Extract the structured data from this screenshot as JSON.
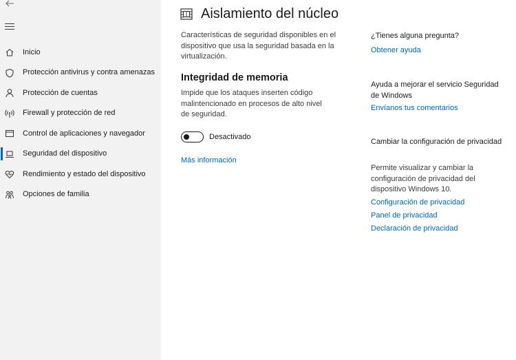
{
  "sidebar": {
    "items": [
      {
        "label": "Inicio",
        "icon": "home-icon"
      },
      {
        "label": "Protección antivirus y contra amenazas",
        "icon": "shield-icon"
      },
      {
        "label": "Protección de cuentas",
        "icon": "person-icon"
      },
      {
        "label": "Firewall y protección de red",
        "icon": "wifi-antenna-icon"
      },
      {
        "label": "Control de aplicaciones y navegador",
        "icon": "browser-window-icon"
      },
      {
        "label": "Seguridad del dispositivo",
        "icon": "laptop-icon",
        "active": true
      },
      {
        "label": "Rendimiento y estado del dispositivo",
        "icon": "heart-icon"
      },
      {
        "label": "Opciones de familia",
        "icon": "family-icon"
      }
    ]
  },
  "main": {
    "title": "Aislamiento del núcleo",
    "description": "Características de seguridad disponibles en el dispositivo que usa la seguridad basada en la virtualización.",
    "memory_integrity": {
      "title": "Integridad de memoria",
      "description": "Impide que los ataques inserten código malintencionado en procesos de alto nivel de seguridad.",
      "toggle_label": "Desactivado",
      "toggle_on": false
    },
    "more_info": "Más información"
  },
  "right_panel": {
    "question_heading": "¿Tienes alguna pregunta?",
    "help_link": "Obtener ayuda",
    "improve_heading": "Ayuda a mejorar el servicio Seguridad de Windows",
    "feedback_link": "Envíanos tus comentarios",
    "privacy_heading": "Cambiar la configuración de privacidad",
    "privacy_text": "Permite visualizar y cambiar la configuración de privacidad del dispositivo Windows 10.",
    "privacy_links": [
      "Configuración de privacidad",
      "Panel de privacidad",
      "Declaración de privacidad"
    ]
  },
  "colors": {
    "accent": "#0067b8",
    "sidebar_bg": "#f2f2f2"
  }
}
